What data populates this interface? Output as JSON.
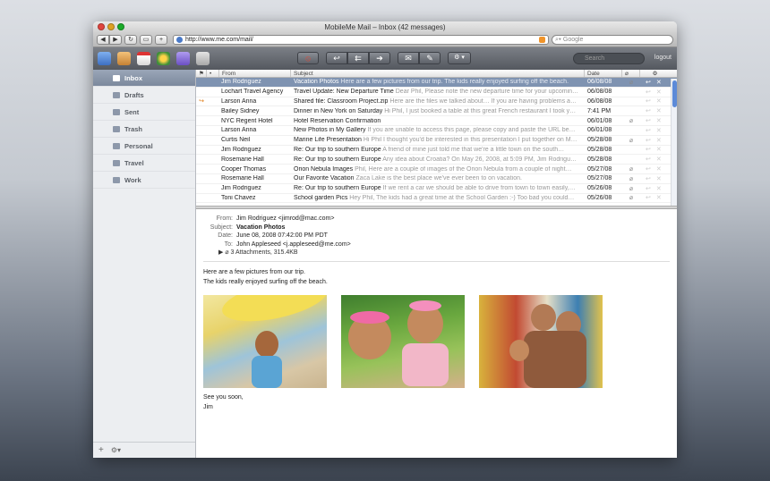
{
  "window": {
    "title": "MobileMe Mail – Inbox (42 messages)"
  },
  "browser": {
    "url": "http://www.me.com/mail/",
    "search_placeholder": "Google",
    "nav_back": "◀",
    "nav_forward": "▶",
    "reload": "↻",
    "plus": "+"
  },
  "appbar": {
    "search_placeholder": "Search",
    "logout": "logout",
    "buttons": {
      "junk": "⦸",
      "reply": "↩",
      "reply_all": "⇇",
      "forward": "➔",
      "compose": "✉",
      "note": "✎",
      "action": "⚙ ▾"
    }
  },
  "sidebar": {
    "folders": [
      {
        "label": "Inbox"
      },
      {
        "label": "Drafts"
      },
      {
        "label": "Sent"
      },
      {
        "label": "Trash"
      },
      {
        "label": "Personal"
      },
      {
        "label": "Travel"
      },
      {
        "label": "Work"
      }
    ],
    "footer": {
      "add": "+",
      "gear": "⚙▾"
    }
  },
  "list": {
    "columns": {
      "from": "From",
      "subject": "Subject",
      "date": "Date"
    },
    "rows": [
      {
        "from": "Jim Rodriguez",
        "subject": "Vacation Photos",
        "preview": "Here are a few pictures from our trip. The kids really enjoyed surfing off the beach.",
        "date": "06/08/08",
        "flag": "",
        "attach": "⌀"
      },
      {
        "from": "Lochart Travel Agency",
        "subject": "Travel Update: New Departure Time",
        "preview": "Dear Phil, Please note the new departure time for your upcomin…",
        "date": "06/08/08",
        "flag": "",
        "attach": ""
      },
      {
        "from": "Larson Anna",
        "subject": "Shared file: Classroom Project.zip",
        "preview": "Here are the files we talked about… If you are having problems a…",
        "date": "06/08/08",
        "flag": "↪",
        "attach": ""
      },
      {
        "from": "Bailey Sidney",
        "subject": "Dinner in New York on Saturday",
        "preview": "Hi Phil, I just booked a table at this great French restaurant I took y…",
        "date": "7:41 PM",
        "flag": "",
        "attach": ""
      },
      {
        "from": "NYC Regent Hotel",
        "subject": "Hotel Reservation Confirmation",
        "preview": "",
        "date": "06/01/08",
        "flag": "",
        "attach": "⌀"
      },
      {
        "from": "Larson Anna",
        "subject": "New Photos in My Gallery",
        "preview": "If you are unable to access this page, please copy and paste the URL be…",
        "date": "06/01/08",
        "flag": "",
        "attach": ""
      },
      {
        "from": "Curtis Neil",
        "subject": "Marine Life Presentation",
        "preview": "Hi Phil I thought you'd be interested in this presentation I put together on M…",
        "date": "05/28/08",
        "flag": "",
        "attach": "⌀"
      },
      {
        "from": "Jim Rodriguez",
        "subject": "Re: Our trip to southern Europe",
        "preview": "A friend of mine just told me that we're a little town on the south…",
        "date": "05/28/08",
        "flag": "",
        "attach": ""
      },
      {
        "from": "Rosemarie Hall",
        "subject": "Re: Our trip to southern Europe",
        "preview": "Any idea about Croatia? On May 26, 2008, at 5:09 PM, Jim Rodrigu…",
        "date": "05/28/08",
        "flag": "",
        "attach": ""
      },
      {
        "from": "Cooper Thomas",
        "subject": "Orion Nebula Images",
        "preview": "Phil, Here are a couple of images of the Orion Nebula from a couple of night…",
        "date": "05/27/08",
        "flag": "",
        "attach": "⌀"
      },
      {
        "from": "Rosemarie Hall",
        "subject": "Our Favorite Vacation",
        "preview": "Zaca Lake is the best place we've ever been to on vacation.",
        "date": "05/27/08",
        "flag": "",
        "attach": "⌀"
      },
      {
        "from": "Jim Rodriguez",
        "subject": "Re: Our trip to southern Europe",
        "preview": "If we rent a car we should be able to drive from town to town easily,…",
        "date": "05/26/08",
        "flag": "",
        "attach": "⌀"
      },
      {
        "from": "Toni Chavez",
        "subject": "School garden Pics",
        "preview": "Hey Phil, The kids had a great time at the School Garden :-) Too bad you could…",
        "date": "05/26/08",
        "flag": "",
        "attach": "⌀"
      }
    ]
  },
  "message": {
    "labels": {
      "from": "From:",
      "subject": "Subject:",
      "date": "Date:",
      "to": "To:"
    },
    "from": "Jim Rodriguez <jimrod@mac.com>",
    "subject": "Vacation Photos",
    "date": "June 08, 2008 07:42:00 PM PDT",
    "to": "John Appleseed <j.appleseed@me.com>",
    "attachments": "3 Attachments, 315.4KB",
    "body_line1": "Here are a few pictures from our trip.",
    "body_line2": "The kids really enjoyed surfing off the beach.",
    "closing1": "See you soon,",
    "closing2": "Jim"
  }
}
